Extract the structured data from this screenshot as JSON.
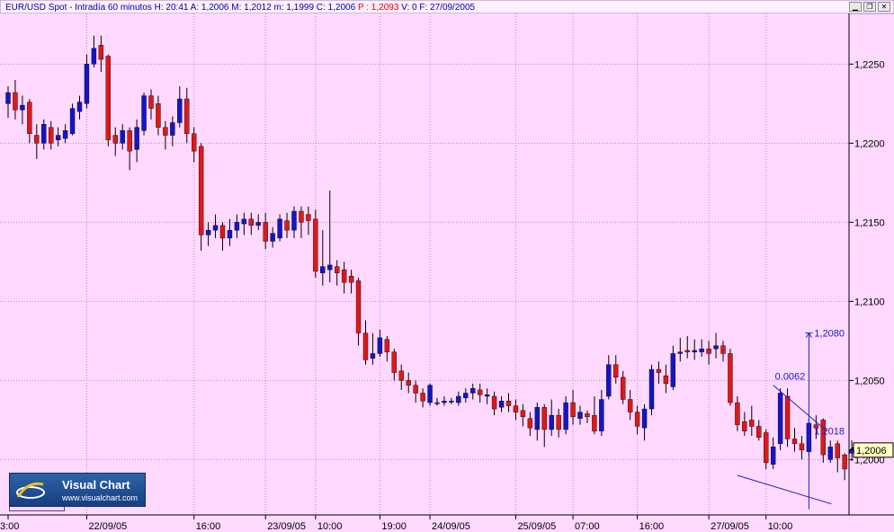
{
  "header": {
    "title_segments": [
      {
        "text": "EUR/USD Spot - Intradía 60 minutos",
        "color": "#0000a0"
      },
      {
        "text": "H: 20:41",
        "color": "#0000a0"
      },
      {
        "text": "A: 1,2006",
        "color": "#0000a0"
      },
      {
        "text": "M: 1,2012",
        "color": "#0000a0"
      },
      {
        "text": "m: 1,1999",
        "color": "#0000a0"
      },
      {
        "text": "C: 1,2006",
        "color": "#0000a0"
      },
      {
        "text": "P : 1,2093",
        "color": "#e00000"
      },
      {
        "text": "V: 0",
        "color": "#0000a0"
      },
      {
        "text": "F: 27/09/2005",
        "color": "#0000a0"
      }
    ]
  },
  "window_buttons": {
    "minimize": "▁",
    "restore": "❐",
    "close": "✕"
  },
  "logo": {
    "brand": "Visual Chart",
    "url": "www.visualchart.com"
  },
  "colors": {
    "background": "#ffd9ff",
    "grid": "#b48ad0",
    "up_candle": "#1414c8",
    "down_candle": "#e01818",
    "wick": "#000000",
    "trendline": "#2020c0",
    "price_box": "#ffffc0"
  },
  "chart_data": {
    "type": "candlestick",
    "instrument": "EUR/USD Spot",
    "ylim": [
      1.1965,
      1.2282
    ],
    "yticks": [
      {
        "value": 1.2,
        "label": "1,2000"
      },
      {
        "value": 1.205,
        "label": "1,2050"
      },
      {
        "value": 1.21,
        "label": "1,2100"
      },
      {
        "value": 1.215,
        "label": "1,2150"
      },
      {
        "value": 1.22,
        "label": "1,2200"
      },
      {
        "value": 1.225,
        "label": "1,2250"
      }
    ],
    "xticks": [
      {
        "index": 0,
        "label": "3:00"
      },
      {
        "index": 11,
        "label": "22/09/05"
      },
      {
        "index": 26,
        "label": "16:00"
      },
      {
        "index": 36,
        "label": "23/09/05"
      },
      {
        "index": 43,
        "label": "10:00"
      },
      {
        "index": 52,
        "label": "19:00"
      },
      {
        "index": 59,
        "label": "24/09/05"
      },
      {
        "index": 71,
        "label": "25/09/05"
      },
      {
        "index": 79,
        "label": "07:00"
      },
      {
        "index": 88,
        "label": "16:00"
      },
      {
        "index": 98,
        "label": "27/09/05"
      },
      {
        "index": 106,
        "label": "10:00"
      }
    ],
    "candles": [
      [
        1.2225,
        1.2232,
        1.2216,
        1.2236
      ],
      [
        1.2232,
        1.2221,
        1.2215,
        1.224
      ],
      [
        1.2221,
        1.2224,
        1.2212,
        1.223
      ],
      [
        1.2226,
        1.2206,
        1.22,
        1.2228
      ],
      [
        1.2205,
        1.22,
        1.219,
        1.2212
      ],
      [
        1.22,
        1.2212,
        1.2196,
        1.2215
      ],
      [
        1.221,
        1.22,
        1.2196,
        1.2214
      ],
      [
        1.2202,
        1.2205,
        1.2198,
        1.221
      ],
      [
        1.2203,
        1.2208,
        1.22,
        1.2212
      ],
      [
        1.2206,
        1.2222,
        1.2205,
        1.2225
      ],
      [
        1.222,
        1.2226,
        1.2215,
        1.223
      ],
      [
        1.2225,
        1.225,
        1.2222,
        1.2256
      ],
      [
        1.225,
        1.226,
        1.2248,
        1.2268
      ],
      [
        1.2262,
        1.2253,
        1.2245,
        1.2268
      ],
      [
        1.2255,
        1.2202,
        1.2198,
        1.2256
      ],
      [
        1.2205,
        1.22,
        1.2192,
        1.221
      ],
      [
        1.22,
        1.2208,
        1.2196,
        1.2212
      ],
      [
        1.2208,
        1.2195,
        1.2183,
        1.221
      ],
      [
        1.2196,
        1.221,
        1.2188,
        1.2215
      ],
      [
        1.2208,
        1.223,
        1.2205,
        1.2232
      ],
      [
        1.223,
        1.2222,
        1.2215,
        1.2234
      ],
      [
        1.2225,
        1.221,
        1.2205,
        1.223
      ],
      [
        1.221,
        1.2205,
        1.2196,
        1.2214
      ],
      [
        1.2205,
        1.2213,
        1.2198,
        1.2217
      ],
      [
        1.2213,
        1.2228,
        1.221,
        1.2236
      ],
      [
        1.2228,
        1.2206,
        1.22,
        1.2235
      ],
      [
        1.2206,
        1.2195,
        1.2188,
        1.221
      ],
      [
        1.2198,
        1.2142,
        1.2132,
        1.22
      ],
      [
        1.2142,
        1.2145,
        1.2135,
        1.215
      ],
      [
        1.2145,
        1.2148,
        1.214,
        1.2155
      ],
      [
        1.2148,
        1.214,
        1.2132,
        1.215
      ],
      [
        1.214,
        1.2145,
        1.2135,
        1.2152
      ],
      [
        1.2145,
        1.215,
        1.214,
        1.2155
      ],
      [
        1.2149,
        1.2152,
        1.2142,
        1.2156
      ],
      [
        1.2152,
        1.2148,
        1.2142,
        1.2156
      ],
      [
        1.2148,
        1.215,
        1.2145,
        1.2155
      ],
      [
        1.215,
        1.2138,
        1.2133,
        1.2156
      ],
      [
        1.2138,
        1.2143,
        1.2134,
        1.2147
      ],
      [
        1.214,
        1.2152,
        1.2138,
        1.2155
      ],
      [
        1.2151,
        1.2145,
        1.214,
        1.2156
      ],
      [
        1.2145,
        1.2157,
        1.214,
        1.216
      ],
      [
        1.2157,
        1.215,
        1.214,
        1.216
      ],
      [
        1.2155,
        1.2151,
        1.2142,
        1.216
      ],
      [
        1.2152,
        1.2119,
        1.2115,
        1.2158
      ],
      [
        1.2118,
        1.2122,
        1.211,
        1.2145
      ],
      [
        1.212,
        1.2123,
        1.2112,
        1.217
      ],
      [
        1.2122,
        1.2118,
        1.211,
        1.2126
      ],
      [
        1.212,
        1.2112,
        1.2105,
        1.2125
      ],
      [
        1.2116,
        1.2112,
        1.2105,
        1.212
      ],
      [
        1.2113,
        1.208,
        1.2072,
        1.2115
      ],
      [
        1.208,
        1.2063,
        1.206,
        1.2088
      ],
      [
        1.2064,
        1.2067,
        1.206,
        1.208
      ],
      [
        1.2067,
        1.2077,
        1.2065,
        1.2082
      ],
      [
        1.2076,
        1.2068,
        1.2062,
        1.2078
      ],
      [
        1.2068,
        1.2055,
        1.205,
        1.207
      ],
      [
        1.2056,
        1.205,
        1.2044,
        1.206
      ],
      [
        1.205,
        1.2047,
        1.2042,
        1.2055
      ],
      [
        1.2047,
        1.2042,
        1.2036,
        1.205
      ],
      [
        1.2042,
        1.2037,
        1.2033,
        1.2045
      ],
      [
        1.2036,
        1.2047,
        1.2034,
        1.2048
      ],
      [
        1.2036,
        1.2036,
        1.2034,
        1.2039
      ],
      [
        1.2036,
        1.2037,
        1.2034,
        1.204
      ],
      [
        1.2037,
        1.2037,
        1.2035,
        1.2039
      ],
      [
        1.2036,
        1.204,
        1.2034,
        1.2043
      ],
      [
        1.2039,
        1.2042,
        1.2036,
        1.2045
      ],
      [
        1.2042,
        1.2045,
        1.2038,
        1.2048
      ],
      [
        1.2044,
        1.2041,
        1.2036,
        1.2048
      ],
      [
        1.204,
        1.2041,
        1.2035,
        1.2045
      ],
      [
        1.204,
        1.2032,
        1.2028,
        1.2043
      ],
      [
        1.2033,
        1.2037,
        1.203,
        1.204
      ],
      [
        1.2037,
        1.2034,
        1.203,
        1.2042
      ],
      [
        1.2034,
        1.203,
        1.2025,
        1.2038
      ],
      [
        1.2031,
        1.2027,
        1.2021,
        1.2035
      ],
      [
        1.2026,
        1.202,
        1.2015,
        1.203
      ],
      [
        1.2019,
        1.2033,
        1.2012,
        1.2036
      ],
      [
        1.2033,
        1.2019,
        1.2008,
        1.2035
      ],
      [
        1.2019,
        1.2028,
        1.2015,
        1.2038
      ],
      [
        1.2028,
        1.2019,
        1.2014,
        1.2032
      ],
      [
        1.2019,
        1.2036,
        1.2016,
        1.204
      ],
      [
        1.2036,
        1.2027,
        1.2022,
        1.2044
      ],
      [
        1.2026,
        1.203,
        1.2022,
        1.2034
      ],
      [
        1.2029,
        1.2027,
        1.2023,
        1.2031
      ],
      [
        1.2028,
        1.2018,
        1.2016,
        1.204
      ],
      [
        1.2018,
        1.2038,
        1.2015,
        1.2044
      ],
      [
        1.204,
        1.206,
        1.2038,
        1.2066
      ],
      [
        1.206,
        1.2052,
        1.2048,
        1.2066
      ],
      [
        1.2052,
        1.2038,
        1.2035,
        1.2056
      ],
      [
        1.2038,
        1.203,
        1.2025,
        1.2044
      ],
      [
        1.203,
        1.2021,
        1.2016,
        1.2034
      ],
      [
        1.202,
        1.2032,
        1.2012,
        1.2035
      ],
      [
        1.2032,
        1.2057,
        1.2028,
        1.206
      ],
      [
        1.2057,
        1.2055,
        1.2048,
        1.2062
      ],
      [
        1.2053,
        1.2048,
        1.2042,
        1.206
      ],
      [
        1.2046,
        1.2067,
        1.2044,
        1.2072
      ],
      [
        1.2067,
        1.2068,
        1.2062,
        1.2077
      ],
      [
        1.2069,
        1.2068,
        1.2064,
        1.2078
      ],
      [
        1.2068,
        1.2069,
        1.2063,
        1.2076
      ],
      [
        1.2068,
        1.207,
        1.2065,
        1.2076
      ],
      [
        1.207,
        1.2067,
        1.206,
        1.2075
      ],
      [
        1.207,
        1.2072,
        1.2064,
        1.208
      ],
      [
        1.2072,
        1.2067,
        1.2062,
        1.2075
      ],
      [
        1.2067,
        1.2036,
        1.2034,
        1.207
      ],
      [
        1.2036,
        1.2022,
        1.2018,
        1.204
      ],
      [
        1.2024,
        1.2018,
        1.2015,
        1.203
      ],
      [
        1.2025,
        1.2021,
        1.2015,
        1.2034
      ],
      [
        1.2021,
        1.2014,
        1.2012,
        1.2025
      ],
      [
        1.2017,
        1.1998,
        1.1994,
        1.2019
      ],
      [
        1.1997,
        1.2008,
        1.1994,
        1.2014
      ],
      [
        1.201,
        1.2042,
        1.2006,
        1.2045
      ],
      [
        1.204,
        1.2013,
        1.2008,
        1.2045
      ],
      [
        1.2013,
        1.201,
        1.2005,
        1.202
      ],
      [
        1.201,
        1.2006,
        1.2,
        1.2015
      ],
      [
        1.2005,
        1.2023,
        1.2002,
        1.2026
      ],
      [
        1.2022,
        1.202,
        1.2013,
        1.2028
      ],
      [
        1.2025,
        1.2003,
        1.1998,
        1.2026
      ],
      [
        1.2,
        1.2008,
        1.1998,
        1.2012
      ],
      [
        1.201,
        1.2001,
        1.1992,
        1.2012
      ],
      [
        1.2003,
        1.1994,
        1.1987,
        1.2004
      ],
      [
        1.2004,
        1.2006,
        1.1999,
        1.2012
      ]
    ],
    "annotations": {
      "target_label": "1,2080",
      "target_value": 1.208,
      "mid_label": "1,2018",
      "mid_value": 1.2018,
      "channel_width_label": "0.0062",
      "channel_upper": {
        "from_index": 107,
        "from_value": 1.2047,
        "to_index": 113,
        "to_value": 1.2018
      },
      "channel_lower": {
        "from_index": 102,
        "from_value": 1.199,
        "to_index": 114,
        "to_value": 1.1972
      },
      "projection_index": 112,
      "last_price_label": "1,2006",
      "last_price_value": 1.2006
    }
  }
}
